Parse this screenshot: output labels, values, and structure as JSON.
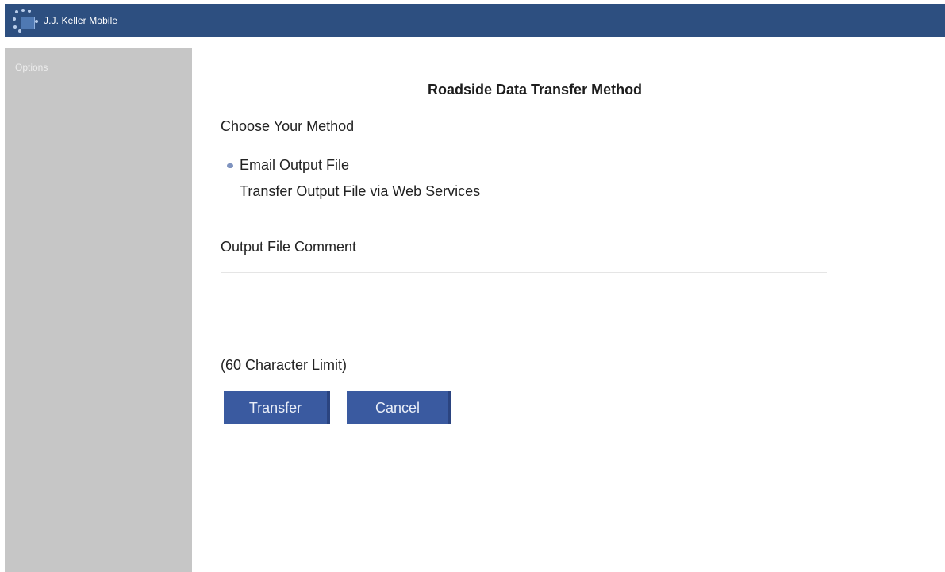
{
  "header": {
    "app_title": "J.J. Keller Mobile",
    "background_color": "#2d4f80"
  },
  "sidebar": {
    "items": [
      {
        "label": "Options"
      }
    ],
    "background_color": "#c6c6c6"
  },
  "main": {
    "title": "Roadside Data Transfer Method",
    "method_section_label": "Choose Your Method",
    "methods": [
      {
        "label": "Email Output File",
        "selected": true
      },
      {
        "label": "Transfer Output File via Web Services",
        "selected": false
      }
    ],
    "comment_label": "Output File Comment",
    "comment": {
      "value": "",
      "placeholder": ""
    },
    "character_limit_note": "(60 Character Limit)",
    "buttons": {
      "transfer_label": "Transfer",
      "cancel_label": "Cancel"
    },
    "button_color": "#3a5aa0"
  }
}
